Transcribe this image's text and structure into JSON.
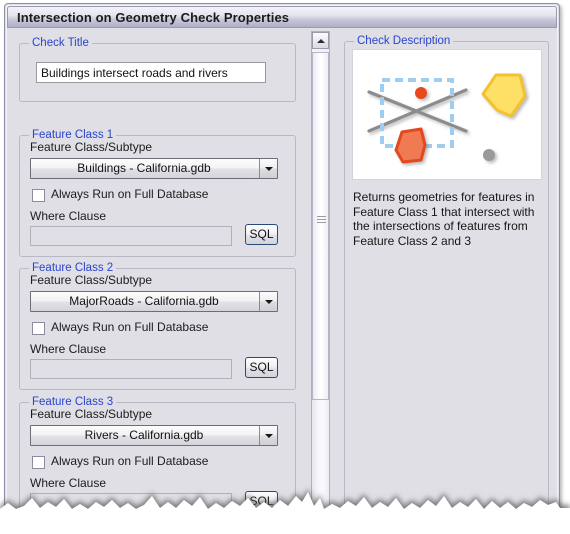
{
  "window": {
    "title": "Intersection on Geometry Check Properties"
  },
  "check_title_group": {
    "legend": "Check Title",
    "value": "Buildings intersect roads and rivers",
    "placeholder": ""
  },
  "feature_classes": [
    {
      "legend": "Feature Class 1",
      "subtype_label": "Feature Class/Subtype",
      "combo_value": "Buildings -  California.gdb",
      "checkbox_label": "Always Run on Full Database",
      "checked": false,
      "where_label": "Where Clause",
      "where_value": "",
      "sql_label": "SQL"
    },
    {
      "legend": "Feature Class 2",
      "subtype_label": "Feature Class/Subtype",
      "combo_value": "MajorRoads -  California.gdb",
      "checkbox_label": "Always Run on Full Database",
      "checked": false,
      "where_label": "Where Clause",
      "where_value": "",
      "sql_label": "SQL"
    },
    {
      "legend": "Feature Class 3",
      "subtype_label": "Feature Class/Subtype",
      "combo_value": "Rivers -  California.gdb",
      "checkbox_label": "Always Run on Full Database",
      "checked": false,
      "where_label": "Where Clause",
      "where_value": "",
      "sql_label": "SQL"
    }
  ],
  "description_panel": {
    "legend": "Check Description",
    "text": "Returns geometries for features in Feature Class 1 that intersect with the intersections of features from Feature Class 2 and 3",
    "illustration": {
      "name": "intersection-diagram",
      "selection_box_color": "#9fcdf0",
      "line_color": "#8c8c8c",
      "red_point_color": "#e8481f",
      "grey_point_color": "#9a9a9a",
      "orange_polygon_color": "#f07a52",
      "orange_polygon_stroke": "#e3481e",
      "yellow_polygon_color": "#ffe066",
      "yellow_polygon_stroke": "#f2c230"
    }
  },
  "scrollbar": {
    "up_arrow": "scroll-up",
    "orientation": "vertical"
  },
  "colors": {
    "legend_blue": "#2a44cc",
    "window_bg": "#dfdfe5",
    "titlebar_text": "#1b1b1b"
  }
}
